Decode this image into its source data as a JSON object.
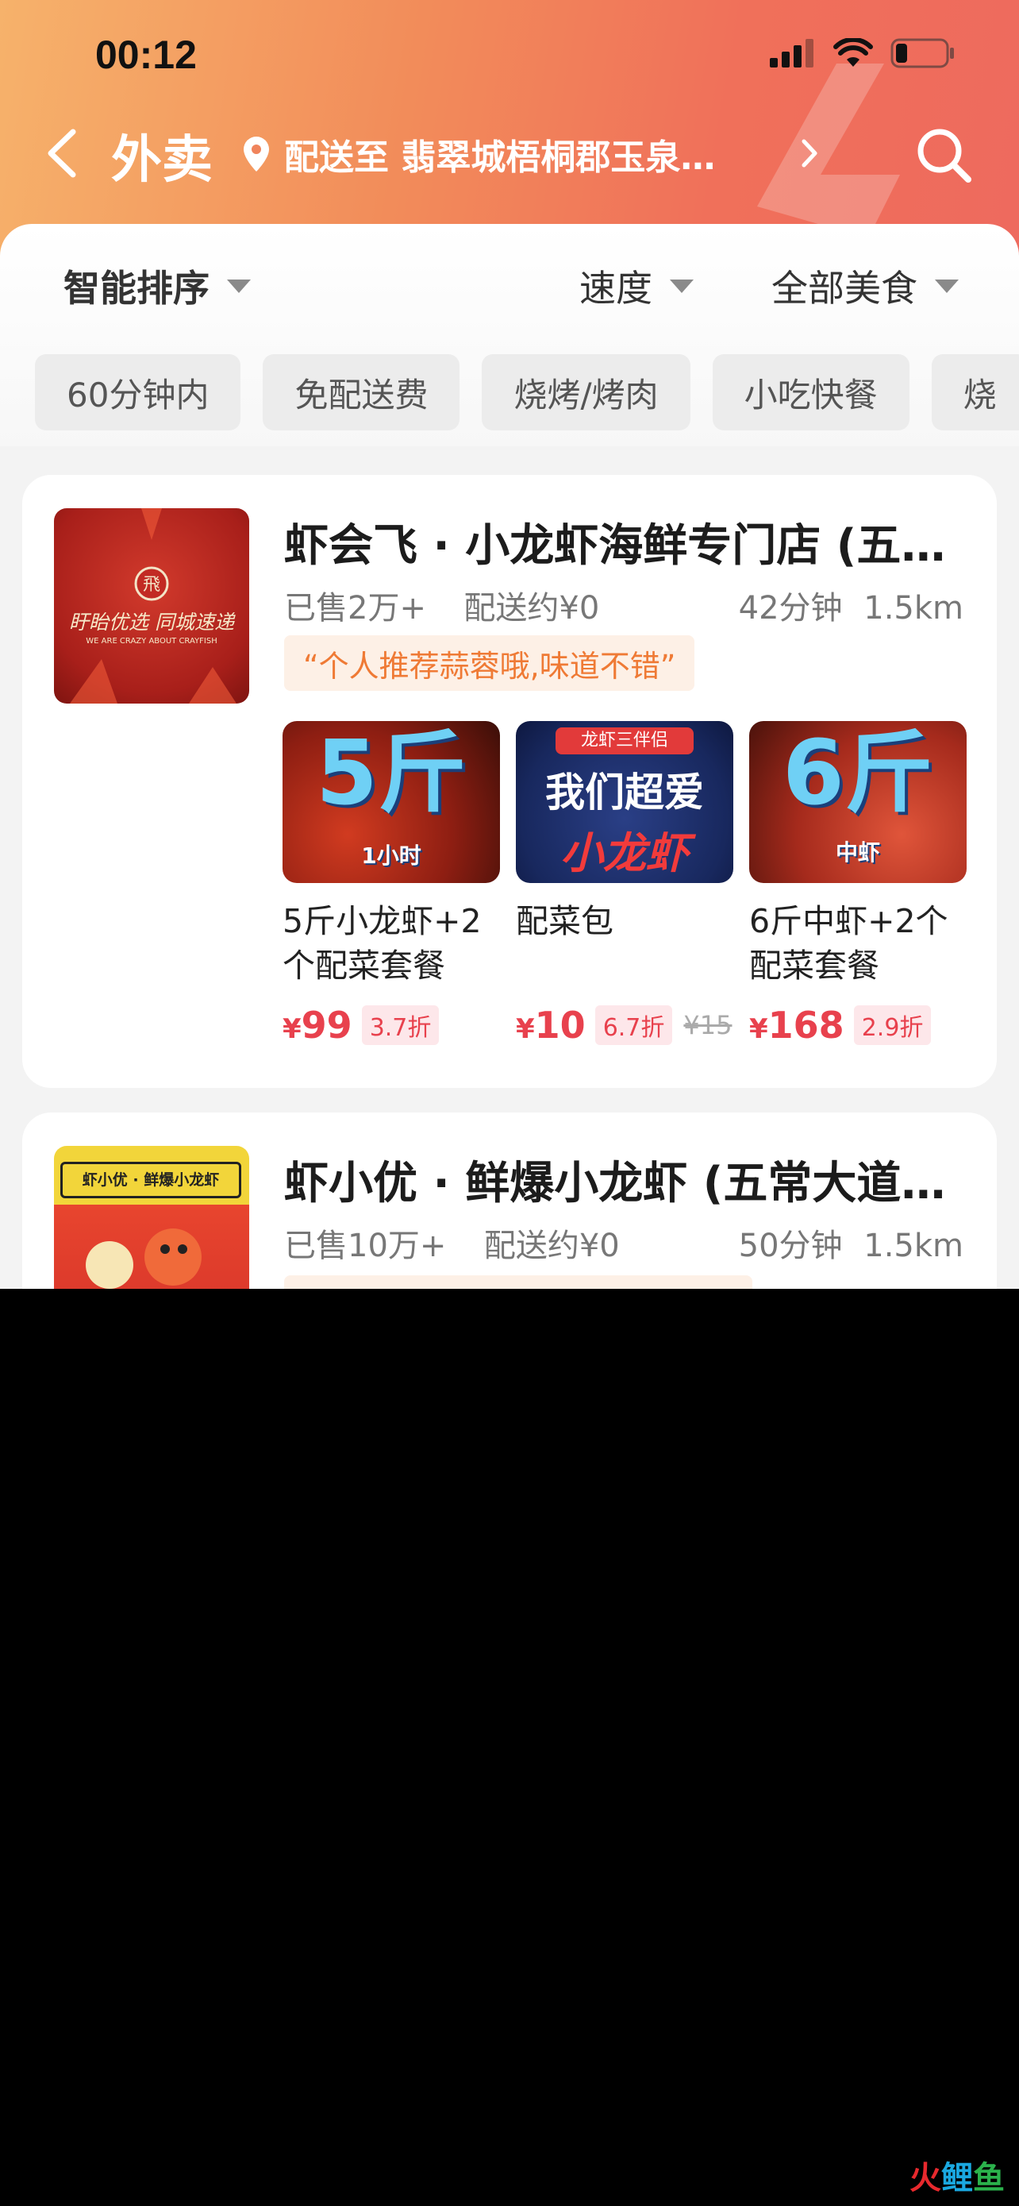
{
  "status_bar": {
    "time": "00:12"
  },
  "nav": {
    "title": "外卖",
    "address": "配送至 翡翠城梧桐郡玉泉…"
  },
  "sort": {
    "smart": "智能排序",
    "speed": "速度",
    "category": "全部美食"
  },
  "chips": [
    "60分钟内",
    "免配送费",
    "烧烤/烤肉",
    "小吃快餐",
    "烧"
  ],
  "stores": [
    {
      "name": "虾会飞 · 小龙虾海鲜专门店 (五…",
      "thumb_text": "盱眙优选 同城速递",
      "thumb_sub": "WE ARE CRAZY ABOUT CRAYFISH",
      "thumb_badge": "飛",
      "sold": "已售2万+",
      "delivery": "配送约¥0",
      "eta": "42分钟",
      "distance": "1.5km",
      "review": "“个人推荐蒜蓉哦,味道不错”",
      "dishes": [
        {
          "img_big": "5斤",
          "img_small": "1小时",
          "name": "5斤小龙虾+2个配菜套餐",
          "price": "99",
          "discount": "3.7折",
          "orig": ""
        },
        {
          "img_big": "我们超爱",
          "img_small": "小龙虾",
          "img_tag": "龙虾三伴侣",
          "name": "配菜包",
          "price": "10",
          "discount": "6.7折",
          "orig": "¥15"
        },
        {
          "img_big": "6斤",
          "img_small": "中虾",
          "name": "6斤中虾+2个配菜套餐",
          "price": "168",
          "discount": "2.9折",
          "orig": ""
        }
      ]
    },
    {
      "name": "虾小优 · 鲜爆小龙虾 (五常大道…",
      "thumb_text": "虾小优 · 鲜爆小龙虾",
      "sold": "已售10万+",
      "delivery": "配送约¥0",
      "eta": "50分钟",
      "distance": "1.5km"
    }
  ],
  "currency": "¥",
  "watermark": {
    "a": "火",
    "b": "鲤",
    "c": "鱼"
  },
  "colors": {
    "accent": "#e8414d",
    "header": "#f0705a",
    "review": "#ef7a35"
  }
}
